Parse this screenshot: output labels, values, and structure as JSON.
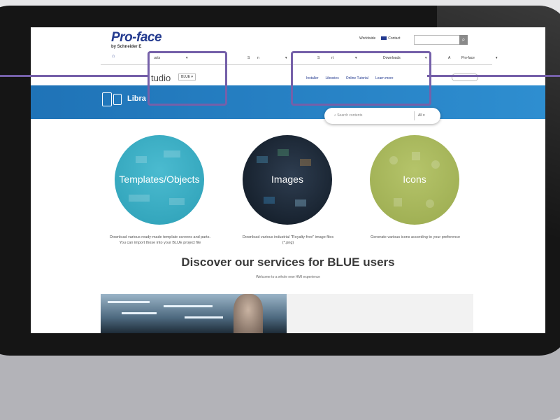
{
  "header": {
    "brand": "Pro-face",
    "brand_sub": "by Schneider E",
    "worldwide": "Worldwide",
    "contact": "Contact"
  },
  "nav": {
    "items": [
      "ucts",
      "S",
      "n",
      "S",
      "rt",
      "Downloads",
      "A",
      "Pro-face"
    ]
  },
  "subnav": {
    "studio": "tudio",
    "version": "BLUE ▾",
    "links": [
      "Installer",
      "Libraries",
      "Online Tutorial",
      "Learn more"
    ]
  },
  "banner": {
    "title": "Libra"
  },
  "content_search": {
    "placeholder": "Search contents",
    "filter": "All ▾"
  },
  "categories": [
    {
      "label": "Templates/Objects",
      "desc_line1": "Download various ready-made template screens and parts.",
      "desc_line2": "You can import those into your BLUE project file"
    },
    {
      "label": "Images",
      "desc_line1": "Download various industrial \"Royalty-free\" image files",
      "desc_line2": "(*.png)"
    },
    {
      "label": "Icons",
      "desc_line1": "Generate various icons according to your preference",
      "desc_line2": ""
    }
  ],
  "services": {
    "heading": "Discover our services for BLUE users",
    "subheading": "Welcome to a whole new HMI experience"
  },
  "colors": {
    "brand_blue": "#233a8f",
    "banner_blue": "#1f73b7",
    "highlight": "#7560a9",
    "teal": "#2c9fb6",
    "olive": "#9aaa4e"
  }
}
